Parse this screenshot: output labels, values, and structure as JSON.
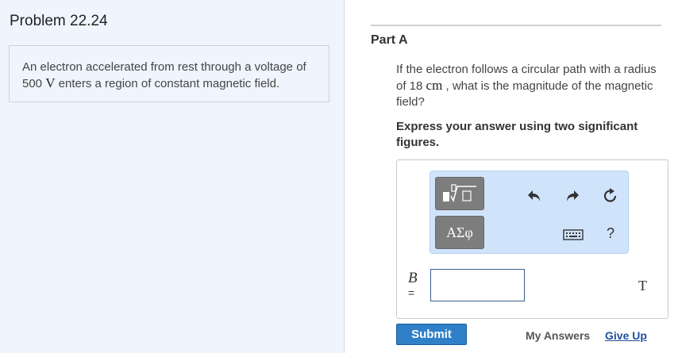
{
  "problem": {
    "title": "Problem 22.24",
    "text_part1": "An electron accelerated from rest through a voltage of 500 ",
    "voltage_unit": "V",
    "text_part2": " enters a region of constant magnetic field."
  },
  "part": {
    "title": "Part A",
    "question_part1": "If the electron follows a circular path with a radius of 18 ",
    "radius_unit": "cm",
    "question_part2": " , what is the magnitude of the magnetic field?",
    "instruction": "Express your answer using two significant figures."
  },
  "toolbar": {
    "symbols_label": "ΑΣφ",
    "help_label": "?"
  },
  "answer": {
    "variable": "B",
    "equals": "=",
    "value": "",
    "unit": "T"
  },
  "actions": {
    "submit_label": "Submit",
    "my_answers_label": "My Answers",
    "give_up_label": "Give Up"
  },
  "colors": {
    "left_panel_bg": "#eef5fd",
    "toolbar_bg": "#cfe3fb",
    "submit_bg": "#2f80c9",
    "link": "#1f4f9a"
  }
}
